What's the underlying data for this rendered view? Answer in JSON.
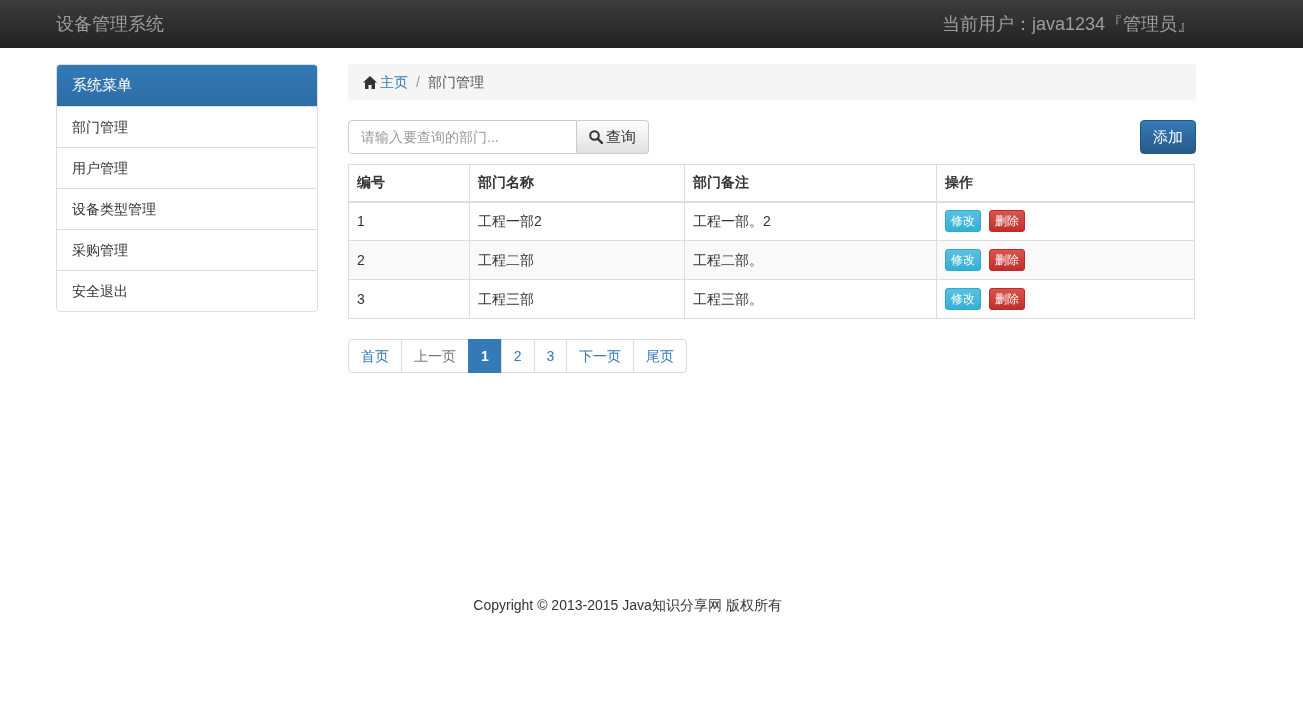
{
  "navbar": {
    "brand": "设备管理系统",
    "user": "当前用户：java1234『管理员』"
  },
  "sidebar": {
    "title": "系统菜单",
    "items": [
      {
        "label": "部门管理"
      },
      {
        "label": "用户管理"
      },
      {
        "label": "设备类型管理"
      },
      {
        "label": "采购管理"
      },
      {
        "label": "安全退出"
      }
    ]
  },
  "breadcrumb": {
    "home": "主页",
    "separator": "/",
    "current": "部门管理"
  },
  "search": {
    "placeholder": "请输入要查询的部门...",
    "button": "查询"
  },
  "add_button": "添加",
  "table": {
    "columns": [
      "编号",
      "部门名称",
      "部门备注",
      "操作"
    ],
    "rows": [
      {
        "cells": [
          "1",
          "工程一部2",
          "工程一部。2"
        ],
        "actions": [
          "修改",
          "删除"
        ]
      },
      {
        "cells": [
          "2",
          "工程二部",
          "工程二部。"
        ],
        "actions": [
          "修改",
          "删除"
        ]
      },
      {
        "cells": [
          "3",
          "工程三部",
          "工程三部。"
        ],
        "actions": [
          "修改",
          "删除"
        ]
      }
    ]
  },
  "pagination": [
    {
      "label": "首页",
      "selected": false,
      "disabled": false
    },
    {
      "label": "上一页",
      "selected": false,
      "disabled": true
    },
    {
      "label": "1",
      "selected": true,
      "disabled": false
    },
    {
      "label": "2",
      "selected": false,
      "disabled": false
    },
    {
      "label": "3",
      "selected": false,
      "disabled": false
    },
    {
      "label": "下一页",
      "selected": false,
      "disabled": false
    },
    {
      "label": "尾页",
      "selected": false,
      "disabled": false
    }
  ],
  "footer": "Copyright © 2013-2015 Java知识分享网 版权所有"
}
